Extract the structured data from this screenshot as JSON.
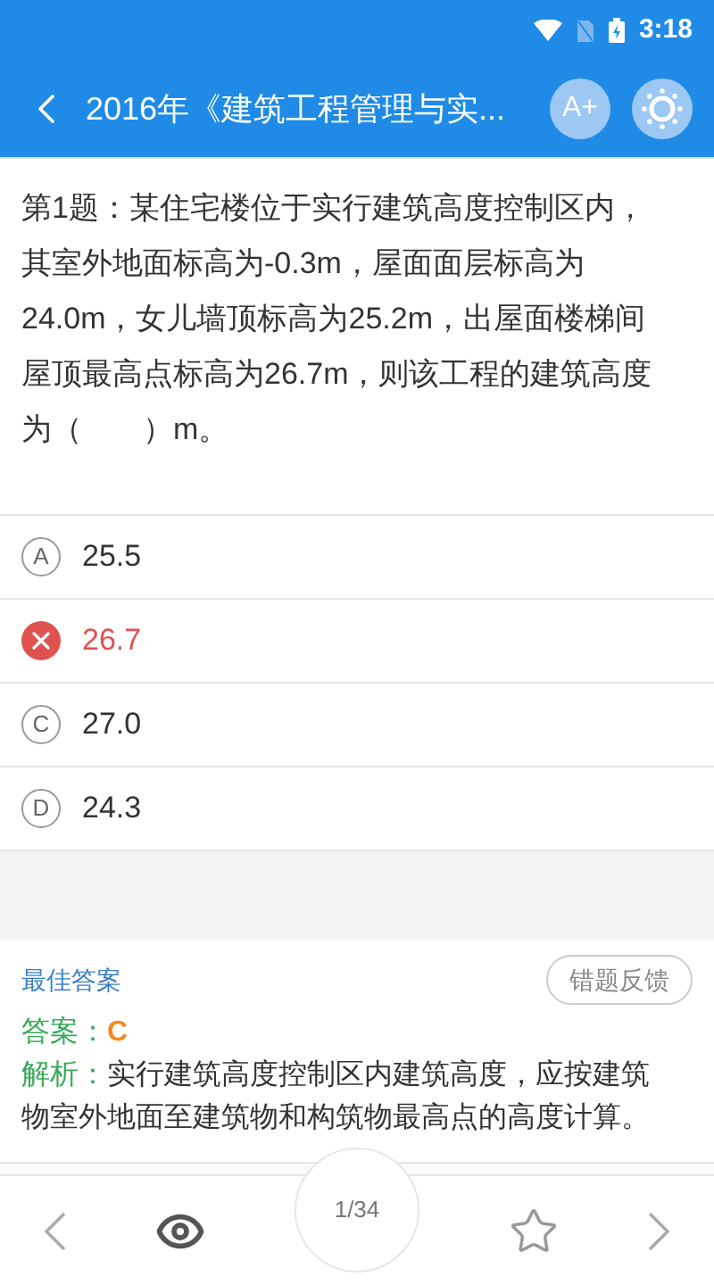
{
  "status_bar": {
    "time": "3:18"
  },
  "header": {
    "title": "2016年《建筑工程管理与实...",
    "font_button": "A+"
  },
  "question": {
    "text": "第1题：某住宅楼位于实行建筑高度控制区内，其室外地面标高为-0.3m，屋面面层标高为24.0m，女儿墙顶标高为25.2m，出屋面楼梯间屋顶最高点标高为26.7m，则该工程的建筑高度为（　　）m。"
  },
  "options": [
    {
      "letter": "A",
      "text": "25.5",
      "marked_wrong": false
    },
    {
      "text": "26.7",
      "marked_wrong": true
    },
    {
      "letter": "C",
      "text": "27.0",
      "marked_wrong": false
    },
    {
      "letter": "D",
      "text": "24.3",
      "marked_wrong": false
    }
  ],
  "answer_card": {
    "title": "最佳答案",
    "feedback_button": "错题反馈",
    "answer_label": "答案：",
    "answer": "C",
    "analysis_label": "解析：",
    "analysis": "实行建筑高度控制区内建筑高度，应按建筑物室外地面至建筑物和构筑物最高点的高度计算。"
  },
  "bottom_bar": {
    "progress": "1/34"
  }
}
